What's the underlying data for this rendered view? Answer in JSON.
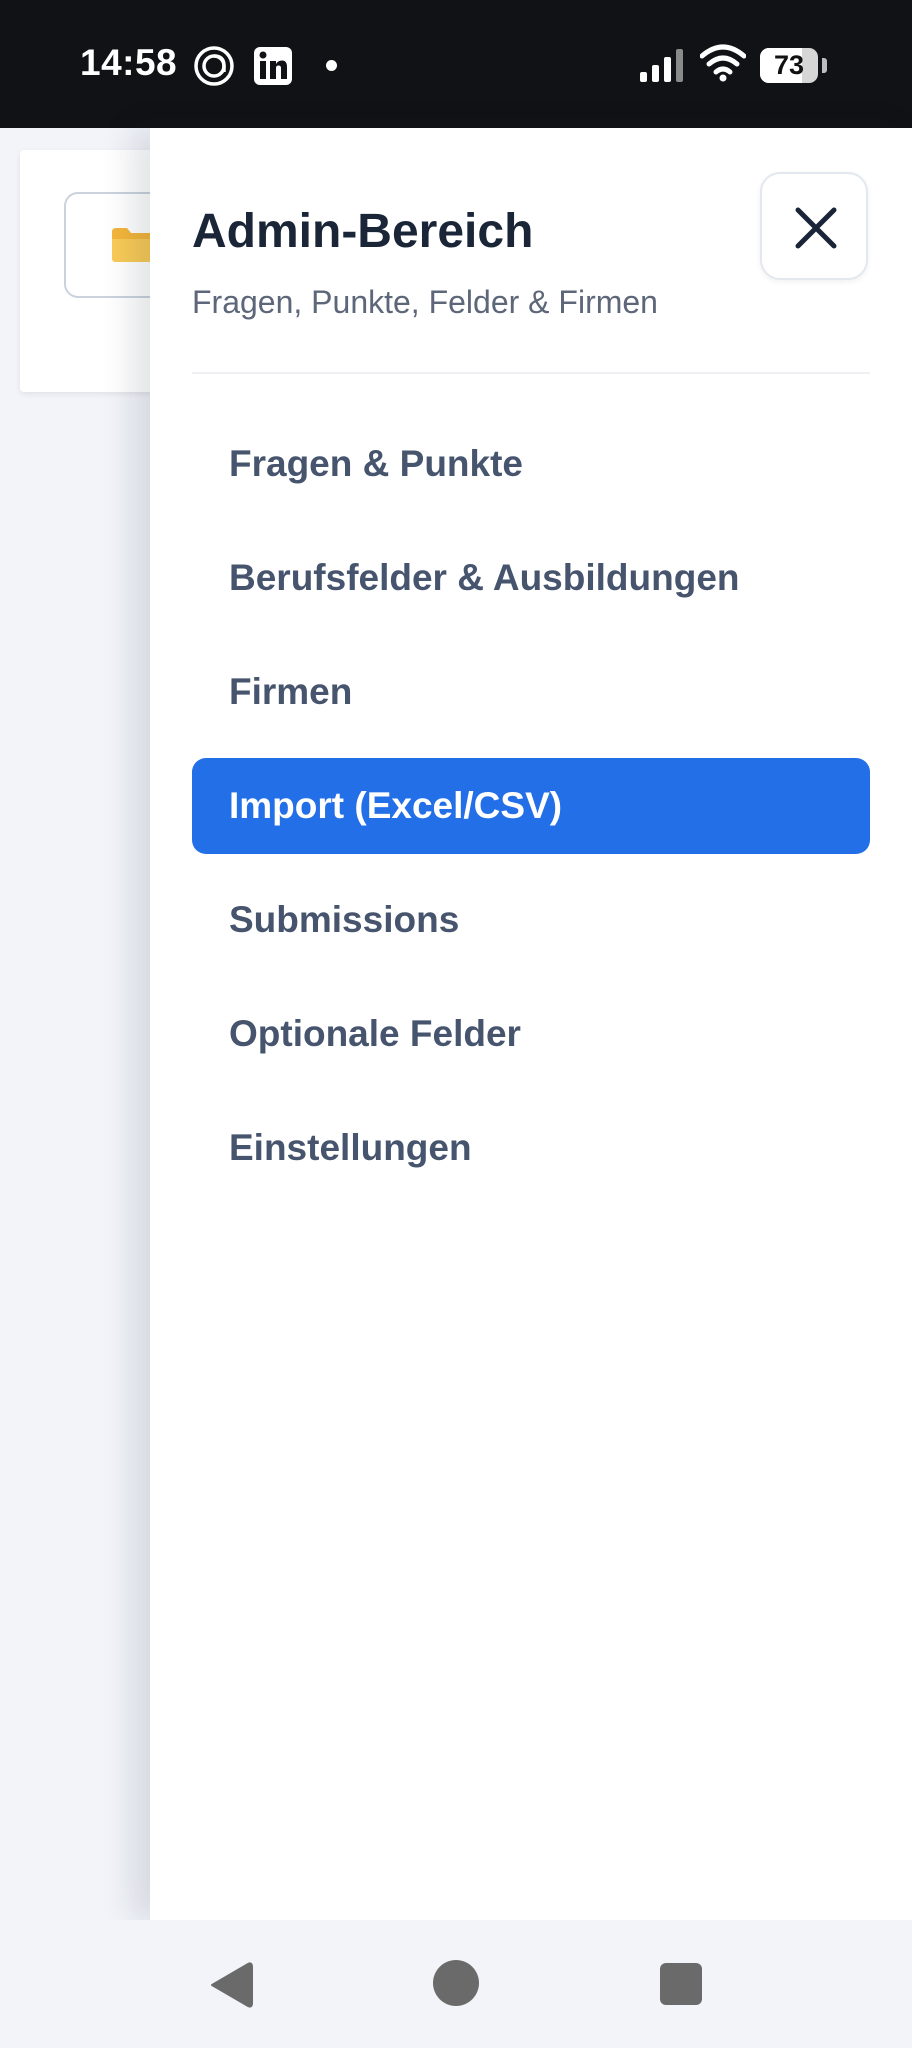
{
  "status_bar": {
    "time": "14:58",
    "icons": [
      "threads-icon",
      "linkedin-icon",
      "notification-dot-icon",
      "signal-icon",
      "wifi-icon",
      "battery-icon"
    ],
    "battery_level": 73,
    "battery_text": "73"
  },
  "background_page": {
    "folder_icon": "folder-icon"
  },
  "drawer": {
    "title": "Admin-Bereich",
    "subtitle": "Fragen, Punkte, Felder & Firmen",
    "close_icon": "close-icon",
    "items": [
      {
        "label": "Fragen & Punkte",
        "active": false
      },
      {
        "label": "Berufsfelder & Ausbildungen",
        "active": false
      },
      {
        "label": "Firmen",
        "active": false
      },
      {
        "label": "Import (Excel/CSV)",
        "active": true
      },
      {
        "label": "Submissions",
        "active": false
      },
      {
        "label": "Optionale Felder",
        "active": false
      },
      {
        "label": "Einstellungen",
        "active": false
      }
    ]
  },
  "colors": {
    "accent": "#226fe8",
    "title": "#1b2538",
    "nav_text": "#46546d",
    "status_bar_bg": "#111215"
  },
  "nav_bar": {
    "icons": [
      "back-icon",
      "home-icon",
      "recent-apps-icon"
    ]
  }
}
